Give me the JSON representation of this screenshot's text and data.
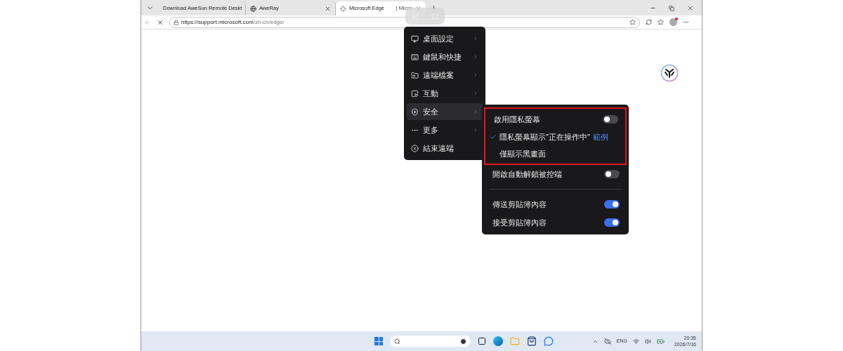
{
  "browser": {
    "tabs": [
      {
        "title": "Download AweSun Remote Deskt",
        "selected": false
      },
      {
        "title": "AweRay",
        "selected": false
      },
      {
        "title": "Microsoft Edge",
        "suffix": "| Micro",
        "selected": true
      }
    ],
    "url_host": "https://support.microsoft.com",
    "url_path": "/zh-cn/edge/"
  },
  "menu": {
    "items": [
      {
        "label": "桌面設定",
        "selected": false
      },
      {
        "label": "鍵鼠和快捷",
        "selected": false
      },
      {
        "label": "遠端檔案",
        "selected": false
      },
      {
        "label": "互動",
        "selected": false
      },
      {
        "label": "安全",
        "selected": true
      },
      {
        "label": "更多",
        "selected": false
      },
      {
        "label": "結束遠端",
        "selected": false,
        "kind": "action"
      }
    ]
  },
  "submenu": {
    "items": [
      {
        "kind": "toggle",
        "label": "啟用隱私螢幕",
        "on": false,
        "highlighted": true
      },
      {
        "kind": "option",
        "label": "隱私螢幕顯示\"正在操作中\"",
        "link": "範例",
        "checked": true,
        "highlighted": true
      },
      {
        "kind": "option",
        "label": "僅顯示黑畫面",
        "checked": false,
        "highlighted": true
      },
      {
        "kind": "toggle",
        "label": "開啟自動解鎖被控端",
        "on": false,
        "highlighted": false
      },
      {
        "kind": "divider"
      },
      {
        "kind": "toggle",
        "label": "傳送剪貼簿內容",
        "on": true,
        "highlighted": false
      },
      {
        "kind": "toggle",
        "label": "接受剪貼簿內容",
        "on": true,
        "highlighted": false
      }
    ]
  },
  "taskbar": {
    "language": "ENG",
    "time": "20:35",
    "date": "2026/7/16"
  }
}
